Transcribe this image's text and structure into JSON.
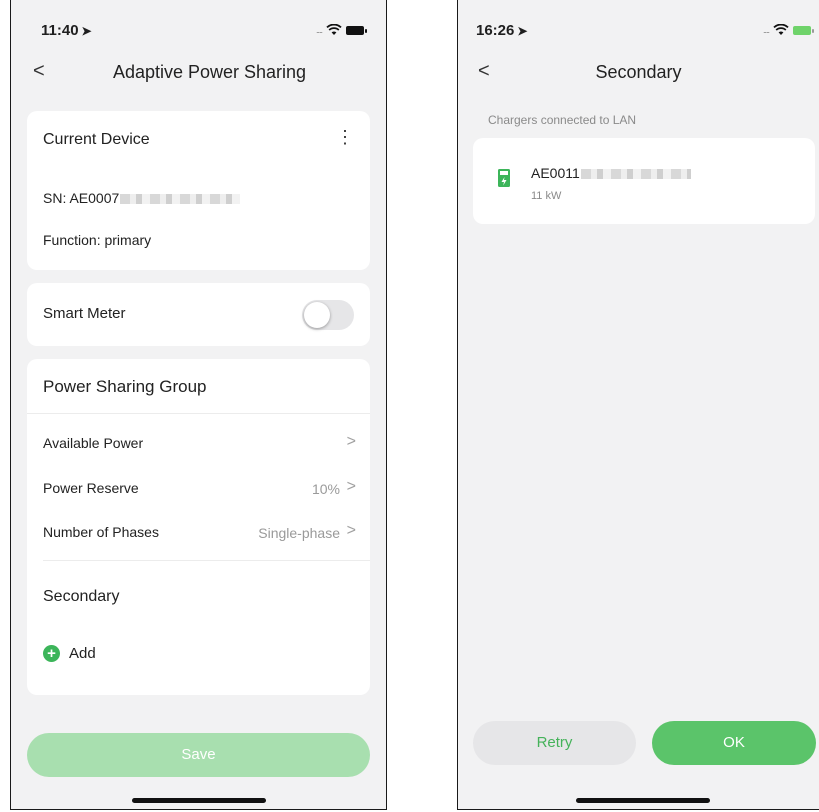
{
  "left": {
    "status": {
      "time": "11:40",
      "location_glyph": "➤"
    },
    "navbar": {
      "back_glyph": "<",
      "title": "Adaptive Power Sharing"
    },
    "current_device": {
      "heading": "Current Device",
      "menu_glyph": "⋮",
      "sn_label": "SN: AE0007",
      "function_label": "Function: primary"
    },
    "smart_meter": {
      "label": "Smart Meter",
      "enabled": false
    },
    "power_sharing_group": {
      "heading": "Power Sharing Group",
      "rows": [
        {
          "label": "Available Power",
          "value": ""
        },
        {
          "label": "Power Reserve",
          "value": "10%"
        },
        {
          "label": "Number of Phases",
          "value": "Single-phase"
        }
      ],
      "secondary_heading": "Secondary",
      "add_label": "Add"
    },
    "save_label": "Save"
  },
  "right": {
    "status": {
      "time": "16:26",
      "location_glyph": "➤"
    },
    "navbar": {
      "back_glyph": "<",
      "title": "Secondary"
    },
    "section_label": "Chargers connected to LAN",
    "charger": {
      "sn": "AE0011",
      "power": "11 kW"
    },
    "retry_label": "Retry",
    "ok_label": "OK"
  },
  "colors": {
    "accent": "#5bc46a",
    "save_disabled": "#a8dfaf",
    "background": "#f2f2f3"
  }
}
